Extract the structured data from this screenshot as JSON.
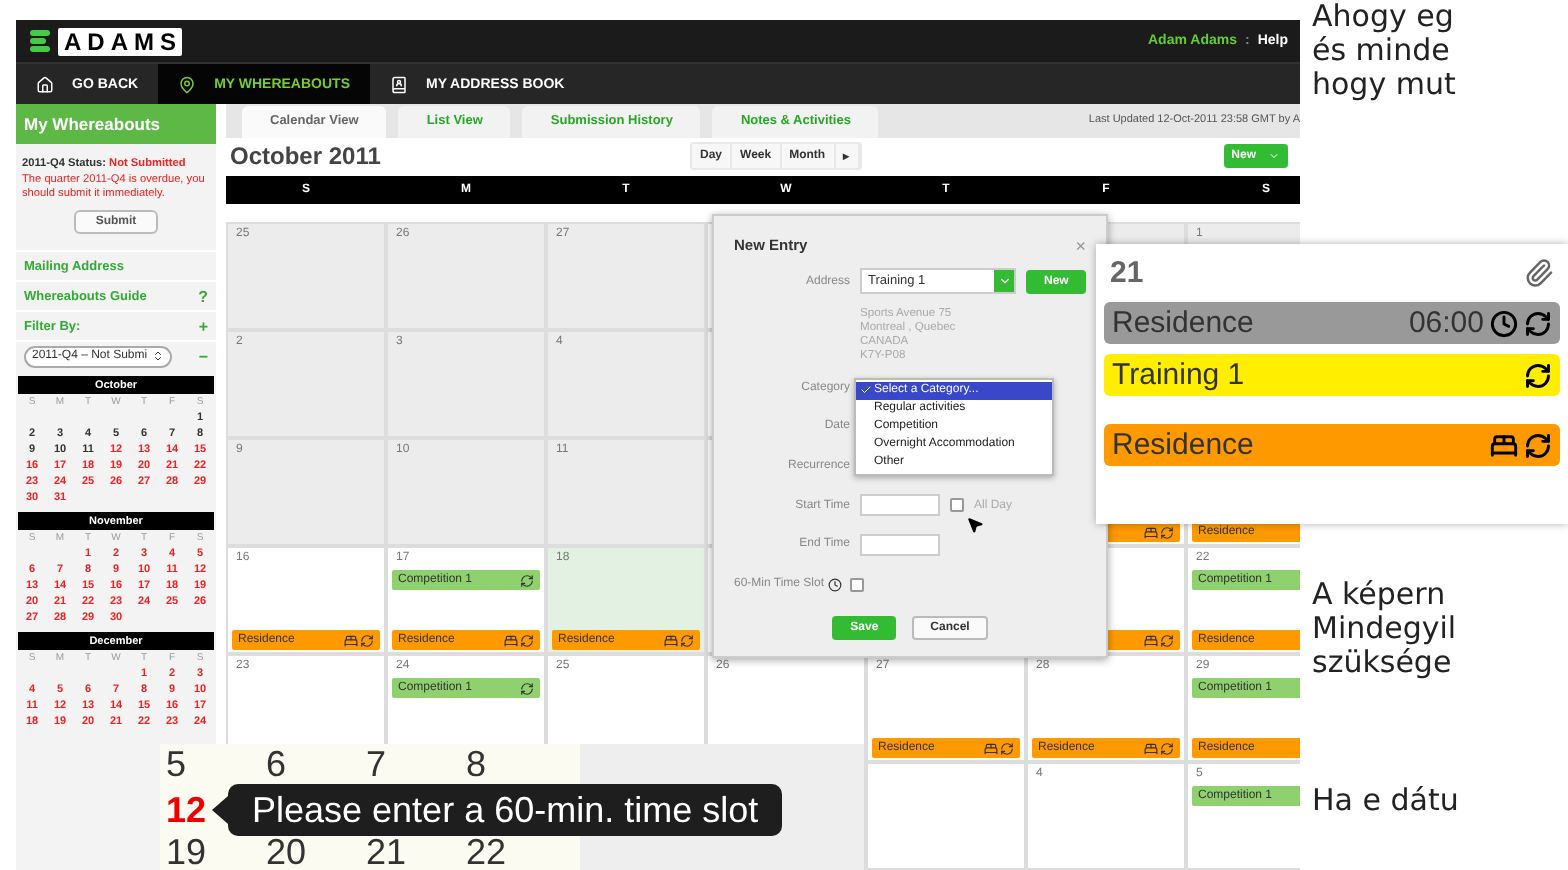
{
  "header": {
    "logo": "ADAMS",
    "user": "Adam Adams",
    "separator": ":",
    "help": "Help"
  },
  "nav": [
    {
      "label": "GO BACK",
      "selected": false
    },
    {
      "label": "MY WHEREABOUTS",
      "selected": true
    },
    {
      "label": "MY ADDRESS BOOK",
      "selected": false
    }
  ],
  "sidebar": {
    "title": "My Whereabouts",
    "status_label": "2011-Q4 Status:",
    "status_value": "Not Submitted",
    "warning": "The quarter 2011-Q4 is overdue, you should submit it immediately.",
    "submit": "Submit",
    "links": [
      {
        "label": "Mailing Address"
      },
      {
        "label": "Whereabouts Guide",
        "action": "?"
      },
      {
        "label": "Filter By:",
        "action": "+"
      }
    ],
    "filter": {
      "value": "2011-Q4 – Not Submi",
      "action": "−"
    },
    "mini_calendars": [
      {
        "month": "October",
        "weekdays": [
          "S",
          "M",
          "T",
          "W",
          "T",
          "F",
          "S"
        ],
        "weeks": [
          [
            {
              "d": "1",
              "red": false
            }
          ],
          [
            {
              "d": "2",
              "red": false
            },
            {
              "d": "3",
              "red": false
            },
            {
              "d": "4",
              "red": false
            },
            {
              "d": "5",
              "red": false
            },
            {
              "d": "6",
              "red": false
            },
            {
              "d": "7",
              "red": false
            },
            {
              "d": "8",
              "red": false
            }
          ],
          [
            {
              "d": "9",
              "red": false
            },
            {
              "d": "10",
              "red": false
            },
            {
              "d": "11",
              "red": false
            },
            {
              "d": "12",
              "red": true
            },
            {
              "d": "13",
              "red": true
            },
            {
              "d": "14",
              "red": true
            },
            {
              "d": "15",
              "red": true
            }
          ],
          [
            {
              "d": "16",
              "red": true
            },
            {
              "d": "17",
              "red": true
            },
            {
              "d": "18",
              "red": true
            },
            {
              "d": "19",
              "red": true
            },
            {
              "d": "20",
              "red": true
            },
            {
              "d": "21",
              "red": true
            },
            {
              "d": "22",
              "red": true
            }
          ],
          [
            {
              "d": "23",
              "red": true
            },
            {
              "d": "24",
              "red": true
            },
            {
              "d": "25",
              "red": true
            },
            {
              "d": "26",
              "red": true
            },
            {
              "d": "27",
              "red": true
            },
            {
              "d": "28",
              "red": true
            },
            {
              "d": "29",
              "red": true
            }
          ],
          [
            {
              "d": "30",
              "red": true
            },
            {
              "d": "31",
              "red": true
            }
          ]
        ]
      },
      {
        "month": "November",
        "weekdays": [
          "S",
          "M",
          "T",
          "W",
          "T",
          "F",
          "S"
        ],
        "weeks": [
          [
            {
              "d": "1",
              "red": true
            },
            {
              "d": "2",
              "red": true
            },
            {
              "d": "3",
              "red": true
            },
            {
              "d": "4",
              "red": true
            },
            {
              "d": "5",
              "red": true
            }
          ],
          [
            {
              "d": "6",
              "red": true
            },
            {
              "d": "7",
              "red": true
            },
            {
              "d": "8",
              "red": true
            },
            {
              "d": "9",
              "red": true
            },
            {
              "d": "10",
              "red": true
            },
            {
              "d": "11",
              "red": true
            },
            {
              "d": "12",
              "red": true
            }
          ],
          [
            {
              "d": "13",
              "red": true
            },
            {
              "d": "14",
              "red": true
            },
            {
              "d": "15",
              "red": true
            },
            {
              "d": "16",
              "red": true
            },
            {
              "d": "17",
              "red": true
            },
            {
              "d": "18",
              "red": true
            },
            {
              "d": "19",
              "red": true
            }
          ],
          [
            {
              "d": "20",
              "red": true
            },
            {
              "d": "21",
              "red": true
            },
            {
              "d": "22",
              "red": true
            },
            {
              "d": "23",
              "red": true
            },
            {
              "d": "24",
              "red": true
            },
            {
              "d": "25",
              "red": true
            },
            {
              "d": "26",
              "red": true
            }
          ],
          [
            {
              "d": "27",
              "red": true
            },
            {
              "d": "28",
              "red": true
            },
            {
              "d": "29",
              "red": true
            },
            {
              "d": "30",
              "red": true
            }
          ]
        ]
      },
      {
        "month": "December",
        "weekdays": [
          "S",
          "M",
          "T",
          "W",
          "T",
          "F",
          "S"
        ],
        "weeks": [
          [
            {
              "d": "1",
              "red": true
            },
            {
              "d": "2",
              "red": true
            },
            {
              "d": "3",
              "red": true
            }
          ],
          [
            {
              "d": "4",
              "red": true
            },
            {
              "d": "5",
              "red": true
            },
            {
              "d": "6",
              "red": true
            },
            {
              "d": "7",
              "red": true
            },
            {
              "d": "8",
              "red": true
            },
            {
              "d": "9",
              "red": true
            },
            {
              "d": "10",
              "red": true
            }
          ],
          [
            {
              "d": "11",
              "red": true
            },
            {
              "d": "12",
              "red": true
            },
            {
              "d": "13",
              "red": true
            },
            {
              "d": "14",
              "red": true
            },
            {
              "d": "15",
              "red": true
            },
            {
              "d": "16",
              "red": true
            },
            {
              "d": "17",
              "red": true
            }
          ],
          [
            {
              "d": "18",
              "red": true
            },
            {
              "d": "19",
              "red": true
            },
            {
              "d": "20",
              "red": true
            },
            {
              "d": "21",
              "red": true
            },
            {
              "d": "22",
              "red": true
            },
            {
              "d": "23",
              "red": true
            },
            {
              "d": "24",
              "red": true
            }
          ]
        ]
      }
    ]
  },
  "main": {
    "tabs": [
      {
        "label": "Calendar View",
        "selected": true
      },
      {
        "label": "List View",
        "selected": false
      },
      {
        "label": "Submission History",
        "selected": false
      },
      {
        "label": "Notes & Activities",
        "selected": false
      }
    ],
    "last_updated": "Last Updated 12-Oct-2011 23:58 GMT by A",
    "title": "October 2011",
    "view_buttons": [
      "Day",
      "Week",
      "Month",
      "▸"
    ],
    "new_button": "New",
    "weekdays": [
      "S",
      "M",
      "T",
      "W",
      "T",
      "F",
      "S"
    ],
    "rows": [
      [
        {
          "day": "25",
          "past": true
        },
        {
          "day": "26",
          "past": true
        },
        {
          "day": "27",
          "past": true
        },
        {},
        {},
        {
          "past": true
        },
        {
          "day": "1",
          "past": true
        }
      ],
      [
        {
          "day": "2",
          "past": true
        },
        {
          "day": "3",
          "past": true
        },
        {
          "day": "4",
          "past": true
        },
        {},
        {},
        {},
        {}
      ],
      [
        {
          "day": "9",
          "past": true
        },
        {
          "day": "10",
          "past": true
        },
        {
          "day": "11",
          "past": true
        },
        {},
        {},
        {
          "past": false,
          "events": [
            {
              "kind": "residence"
            }
          ]
        },
        {
          "past": false,
          "events": [
            {
              "kind": "residence",
              "label": "Residence"
            }
          ]
        }
      ],
      [
        {
          "day": "16",
          "past": false,
          "events": [
            {
              "kind": "residence",
              "label": "Residence"
            }
          ]
        },
        {
          "day": "17",
          "past": false,
          "events": [
            {
              "kind": "competition",
              "label": "Competition 1"
            },
            {
              "kind": "residence",
              "label": "Residence"
            }
          ]
        },
        {
          "day": "18",
          "past": false,
          "selected": true,
          "events": [
            {
              "kind": "residence",
              "label": "Residence"
            }
          ]
        },
        {},
        {},
        {
          "past": false,
          "events": [
            {
              "kind": "residence"
            }
          ]
        },
        {
          "day": "22",
          "past": false,
          "events": [
            {
              "kind": "competition",
              "label": "Competition 1"
            },
            {
              "kind": "residence",
              "label": "Residence"
            }
          ]
        }
      ],
      [
        {
          "day": "23",
          "past": false
        },
        {
          "day": "24",
          "past": false,
          "events": [
            {
              "kind": "competition",
              "label": "Competition 1"
            }
          ]
        },
        {
          "day": "25",
          "past": false
        },
        {
          "day": "26",
          "past": false
        },
        {
          "day": "27",
          "past": false,
          "events": [
            {
              "kind": "residence",
              "label": "Residence"
            }
          ]
        },
        {
          "day": "28",
          "past": false,
          "events": [
            {
              "kind": "residence",
              "label": "Residence"
            }
          ]
        },
        {
          "day": "29",
          "past": false,
          "events": [
            {
              "kind": "competition",
              "label": "Competition 1"
            },
            {
              "kind": "residence",
              "label": "Residence"
            }
          ]
        }
      ],
      [
        {},
        {},
        {},
        {},
        {},
        {
          "day": "4",
          "past": false
        },
        {
          "day": "5",
          "past": false,
          "events": [
            {
              "kind": "competition",
              "label": "Competition 1"
            }
          ]
        }
      ]
    ]
  },
  "dialog": {
    "title": "New Entry",
    "close": "×",
    "address_label": "Address",
    "address_value": "Training 1",
    "new_button": "New",
    "address_lines": [
      "Sports Avenue 75",
      "Montreal , Quebec",
      "CANADA",
      "K7Y-P08"
    ],
    "category_label": "Category",
    "category_options": [
      {
        "label": "Select a Category...",
        "selected": true
      },
      {
        "label": "Regular activities",
        "selected": false
      },
      {
        "label": "Competition",
        "selected": false
      },
      {
        "label": "Overnight Accommodation",
        "selected": false
      },
      {
        "label": "Other",
        "selected": false
      }
    ],
    "date_label": "Date",
    "recurrence_label": "Recurrence",
    "start_label": "Start Time",
    "all_day_label": "All Day",
    "all_day_checked": false,
    "end_label": "End Time",
    "slot_label": "60-Min Time Slot",
    "slot_checked": false,
    "save": "Save",
    "cancel": "Cancel"
  },
  "day_detail": {
    "day": "21",
    "entries": [
      {
        "kind": "timed",
        "label": "Residence",
        "time": "06:00",
        "color": "#999999"
      },
      {
        "kind": "regular",
        "label": "Training 1",
        "color": "#ffee00"
      },
      {
        "kind": "overnight",
        "label": "Residence",
        "color": "#ff9900"
      }
    ]
  },
  "zoom_strip": {
    "rows": [
      [
        {
          "d": "5",
          "red": false
        },
        {
          "d": "6",
          "red": false
        },
        {
          "d": "7",
          "red": false
        },
        {
          "d": "8",
          "red": false
        }
      ],
      [
        {
          "d": "12",
          "red": true
        }
      ],
      [
        {
          "d": "19",
          "red": false
        },
        {
          "d": "20",
          "red": false
        },
        {
          "d": "21",
          "red": false
        },
        {
          "d": "22",
          "red": false
        }
      ]
    ],
    "tooltip": "Please enter a 60-min. time slot"
  },
  "article": [
    [
      "Ahogy eg",
      "és minde",
      "hogy mut"
    ],
    [
      "A képern",
      "Mindegyil",
      "szüksége"
    ],
    [
      "Ha e dátu"
    ]
  ]
}
